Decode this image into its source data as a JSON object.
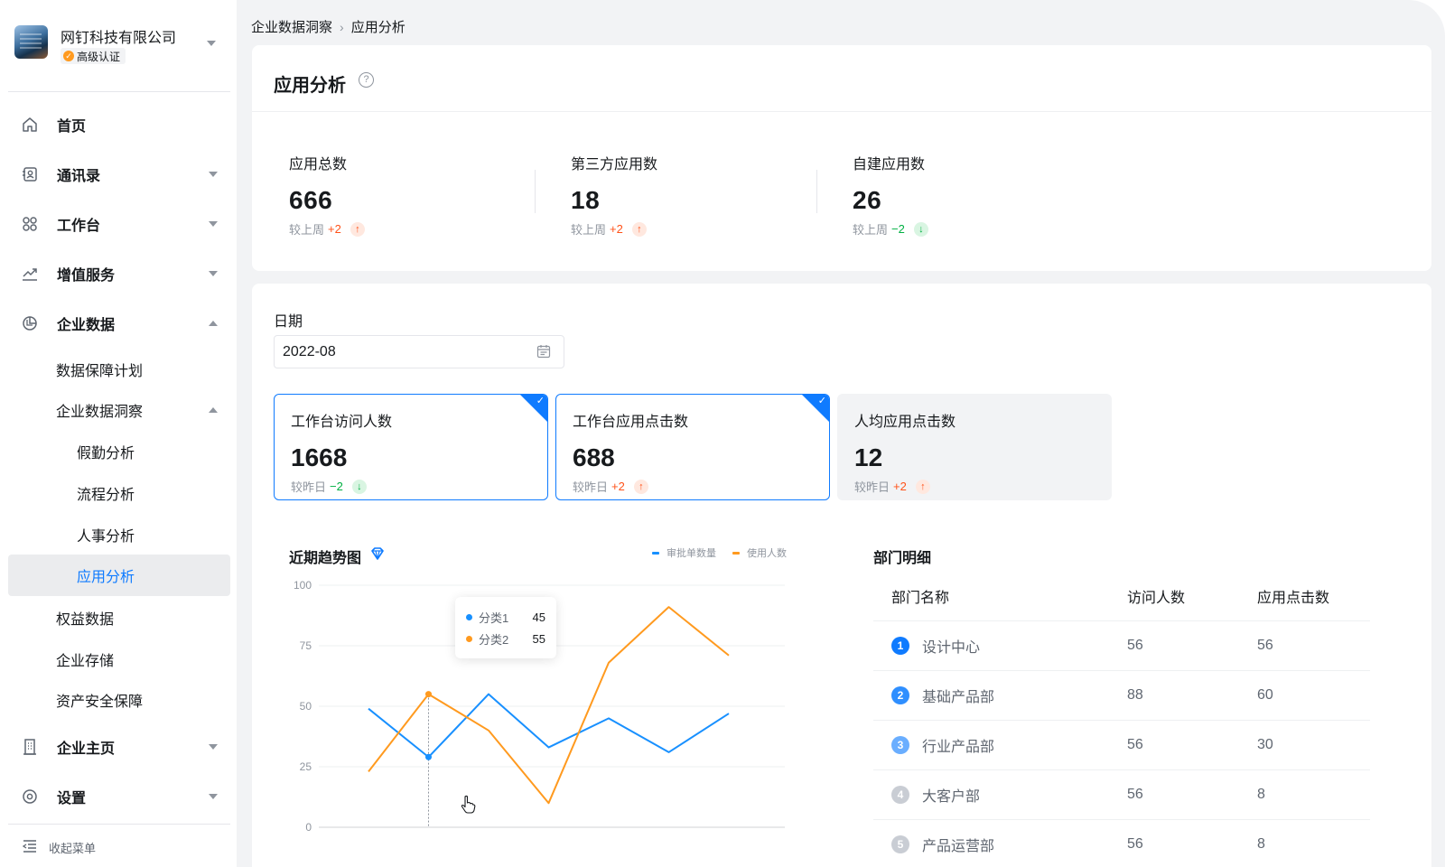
{
  "org": {
    "name": "网钉科技有限公司",
    "badge": "高级认证"
  },
  "nav": {
    "home": "首页",
    "contacts": "通讯录",
    "workbench": "工作台",
    "value_services": "增值服务",
    "enterprise_data": "企业数据",
    "data_guarantee": "数据保障计划",
    "data_insight": "企业数据洞察",
    "leave_analysis": "假勤分析",
    "process_analysis": "流程分析",
    "hr_analysis": "人事分析",
    "app_analysis": "应用分析",
    "rights_data": "权益数据",
    "storage": "企业存储",
    "asset_security": "资产安全保障",
    "enterprise_home": "企业主页",
    "settings": "设置",
    "collapse": "收起菜单"
  },
  "breadcrumb": {
    "parent": "企业数据洞察",
    "current": "应用分析"
  },
  "page": {
    "title": "应用分析"
  },
  "stats": [
    {
      "label": "应用总数",
      "value": "666",
      "delta_prefix": "较上周",
      "delta": "+2",
      "trend": "up"
    },
    {
      "label": "第三方应用数",
      "value": "18",
      "delta_prefix": "较上周",
      "delta": "+2",
      "trend": "up"
    },
    {
      "label": "自建应用数",
      "value": "26",
      "delta_prefix": "较上周",
      "delta": "−2",
      "trend": "down"
    }
  ],
  "date": {
    "label": "日期",
    "value": "2022-08"
  },
  "metrics": [
    {
      "label": "工作台访问人数",
      "value": "1668",
      "delta_prefix": "较昨日",
      "delta": "−2",
      "trend": "down",
      "selected": true
    },
    {
      "label": "工作台应用点击数",
      "value": "688",
      "delta_prefix": "较昨日",
      "delta": "+2",
      "trend": "up",
      "selected": true
    },
    {
      "label": "人均应用点击数",
      "value": "12",
      "delta_prefix": "较昨日",
      "delta": "+2",
      "trend": "up",
      "selected": false
    }
  ],
  "trend": {
    "title": "近期趋势图",
    "legend": [
      "审批单数量",
      "使用人数"
    ],
    "tooltip": [
      {
        "name": "分类1",
        "value": "45"
      },
      {
        "name": "分类2",
        "value": "55"
      }
    ]
  },
  "chart_data": {
    "type": "line",
    "title": "近期趋势图",
    "ylim": [
      0,
      100
    ],
    "yticks": [
      0,
      25,
      50,
      75,
      100
    ],
    "x": [
      1,
      2,
      3,
      4,
      5,
      6,
      7
    ],
    "series": [
      {
        "name": "审批单数量",
        "color": "#1890ff",
        "values": [
          49,
          29,
          55,
          33,
          45,
          31,
          47
        ]
      },
      {
        "name": "使用人数",
        "color": "#ff9a1f",
        "values": [
          23,
          55,
          40,
          10,
          68,
          91,
          71
        ]
      }
    ],
    "highlight_index": 1,
    "grid": true,
    "legend_position": "top-right"
  },
  "dept": {
    "title": "部门明细",
    "headers": [
      "部门名称",
      "访问人数",
      "应用点击数"
    ],
    "rows": [
      {
        "rank": "1",
        "name": "设计中心",
        "visits": "56",
        "clicks": "56"
      },
      {
        "rank": "2",
        "name": "基础产品部",
        "visits": "88",
        "clicks": "60"
      },
      {
        "rank": "3",
        "name": "行业产品部",
        "visits": "56",
        "clicks": "30"
      },
      {
        "rank": "4",
        "name": "大客户部",
        "visits": "56",
        "clicks": "8"
      },
      {
        "rank": "5",
        "name": "产品运营部",
        "visits": "56",
        "clicks": "8"
      }
    ]
  },
  "colors": {
    "accent": "#0f7bff",
    "up": "#ff5219",
    "down": "#00b042"
  }
}
